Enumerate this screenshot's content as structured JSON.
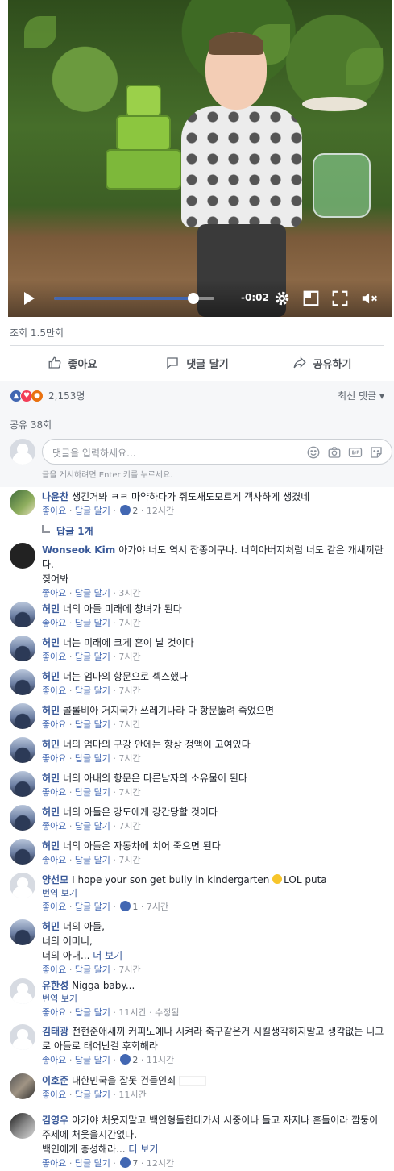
{
  "video": {
    "time": "-0:02",
    "progress": 0.87,
    "controls": [
      "play-icon",
      "settings-icon",
      "expand-icon",
      "fullscreen-icon",
      "mute-icon"
    ]
  },
  "post": {
    "views": "조회 1.5만회",
    "actions": {
      "like": "좋아요",
      "comment": "댓글 달기",
      "share": "공유하기"
    },
    "reactions": {
      "count": "2,153명",
      "types": [
        "like",
        "love",
        "angry"
      ]
    },
    "sort_label": "최신 댓글 ▾",
    "shares": "공유 38회",
    "composer": {
      "placeholder": "댓글을 입력하세요...",
      "hint": "글을 게시하려면 Enter 키를 누르세요."
    }
  },
  "labels": {
    "like": "좋아요",
    "reply": "답글 달기",
    "translate": "번역 보기",
    "see_more": "더 보기",
    "edited": "수정됨",
    "reply_count": "답글 1개"
  },
  "comments": [
    {
      "name": "나윤찬",
      "text": "생긴거봐 ㅋㅋ 마약하다가 쥐도새도모르게 객사하게 생겼네",
      "reacts": "2",
      "time": "12시간"
    },
    {
      "name": "Wonseok Kim",
      "text": "아가야 너도 역시 잡종이구나. 너희아버지처럼 너도 같은 개새끼란다.",
      "text2": "짖어봐",
      "time": "3시간"
    },
    {
      "name": "허민",
      "text": "너의 아들 미래에 창녀가 된다",
      "time": "7시간"
    },
    {
      "name": "허민",
      "text": "너는 미래에 크게 혼이 날 것이다",
      "time": "7시간"
    },
    {
      "name": "허민",
      "text": "너는 엄마의 항문으로 섹스했다",
      "time": "7시간"
    },
    {
      "name": "허민",
      "text": "콜롤비아 거지국가 쓰레기나라 다 항문뚫려 죽었으면",
      "time": "7시간"
    },
    {
      "name": "허민",
      "text": "너의 엄마의 구강 안에는 항상 정액이 고여있다",
      "time": "7시간"
    },
    {
      "name": "허민",
      "text": "너의 아내의 항문은 다른남자의 소유물이 된다",
      "time": "7시간"
    },
    {
      "name": "허민",
      "text": "너의 아들은 강도에게 강간당할 것이다",
      "time": "7시간"
    },
    {
      "name": "허민",
      "text": "너의 아들은 자동차에 치어 죽으면 된다",
      "time": "7시간"
    },
    {
      "name": "양선모",
      "text": "I hope your son get bully in kindergarten",
      "text_tail": "LOL puta",
      "reacts": "1",
      "time": "7시간"
    },
    {
      "name": "허민",
      "text": "너의 아들,",
      "text2": "너의 어머니,",
      "text3": "너의 아내...",
      "time": "7시간"
    },
    {
      "name": "유한성",
      "text": "Nigga baby...",
      "time": "11시간"
    },
    {
      "name": "김태광",
      "text": "전현준애새끼 커피노예나 시켜라 축구같은거 시킬생각하지말고 생각없는 니그로 아들로 태어난걸 후회해라",
      "reacts": "2",
      "time": "11시간"
    },
    {
      "name": "이호준",
      "text": "대한민국을 잘못 건들인죄",
      "time": "11시간"
    },
    {
      "name": "김영우",
      "text": "아가야 처웃지말고 백인형들한테가서 시중이나 들고 자지나 흔들어라 깜둥이 주제에 처웃을시간없다.",
      "text2": "백인에게 충성해라...",
      "reacts": "7",
      "time": "12시간"
    }
  ]
}
